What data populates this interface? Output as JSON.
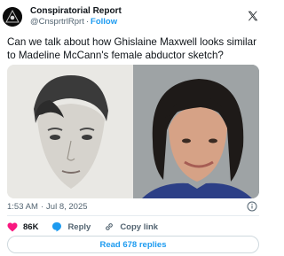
{
  "author": {
    "display_name": "Conspiratorial Report",
    "handle": "@CnsprtrlRprt",
    "follow_label": "Follow",
    "separator": "·"
  },
  "tweet": {
    "text": "Can we talk about how Ghislaine Maxwell looks similar to Madeline McCann's female abductor sketch?",
    "time": "1:53 AM",
    "date": "Jul 8, 2025",
    "separator": "·"
  },
  "media": [
    {
      "name": "sketch-image",
      "icon": "composite-sketch"
    },
    {
      "name": "photo-image",
      "icon": "portrait-photo"
    }
  ],
  "actions": {
    "like_count": "86K",
    "reply_label": "Reply",
    "copy_link_label": "Copy link"
  },
  "read_replies_label": "Read 678 replies",
  "colors": {
    "accent": "#1d9bf0",
    "like": "#f91880",
    "text": "#0f1419",
    "muted": "#536471"
  }
}
